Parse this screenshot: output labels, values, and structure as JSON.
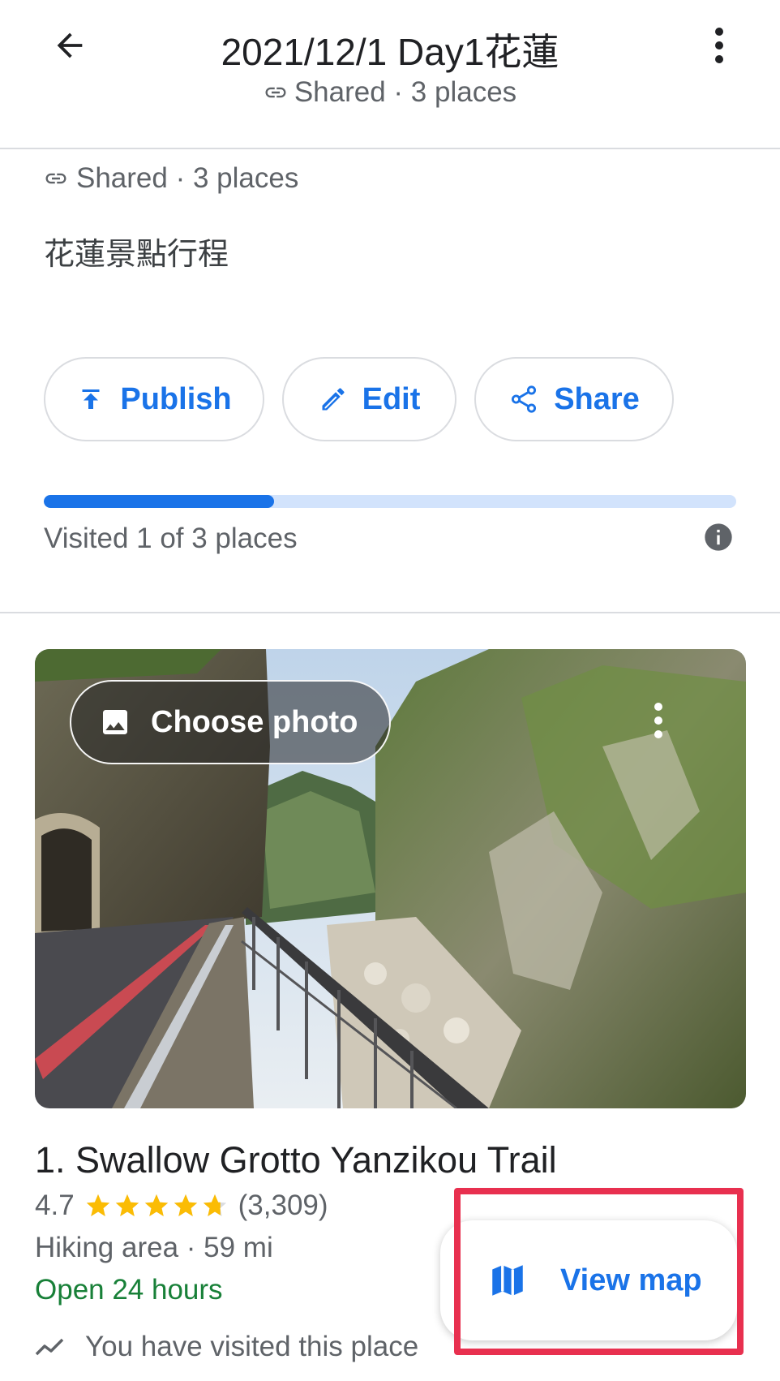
{
  "app_bar": {
    "title": "2021/12/1 Day1花蓮",
    "subtitle": "Shared · 3 places",
    "icons": {
      "back": "arrow-back-icon",
      "more": "more-vert-icon",
      "link": "link-icon"
    }
  },
  "list_info": {
    "sharing": "Shared · 3 places",
    "description": "花蓮景點行程"
  },
  "actions": {
    "publish_label": "Publish",
    "edit_label": "Edit",
    "share_label": "Share"
  },
  "progress": {
    "visited": 1,
    "total": 3,
    "fraction": 0.333,
    "label": "Visited 1 of 3 places"
  },
  "place": {
    "choose_photo_label": "Choose photo",
    "title": "1. Swallow Grotto Yanzikou Trail",
    "rating": "4.7",
    "rating_value": 4.7,
    "review_count": "(3,309)",
    "category": "Hiking area · 59 mi",
    "hours": "Open 24 hours",
    "visited_note": "You have visited this place"
  },
  "fab": {
    "view_map_label": "View map"
  },
  "colors": {
    "accent": "#1a73e8",
    "progress_track": "#d2e3fc",
    "open_green": "#188038",
    "star": "#fbbc04",
    "highlight": "#e8304f"
  }
}
